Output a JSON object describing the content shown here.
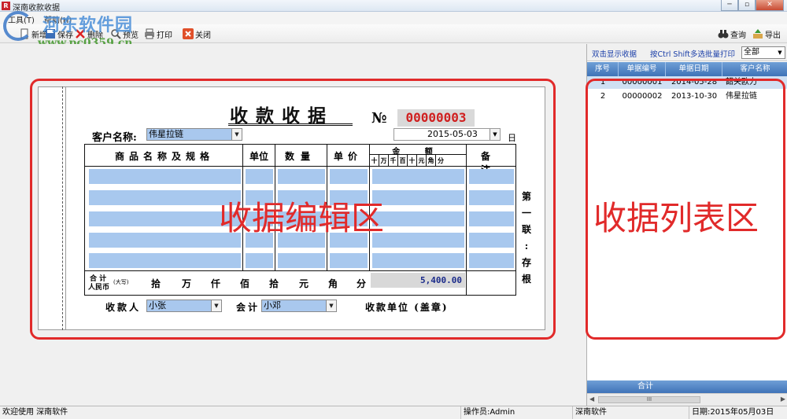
{
  "window": {
    "title": "深南收款收据",
    "controls": [
      "─",
      "▫",
      "✕"
    ]
  },
  "menu": [
    {
      "label": "工具(T)"
    },
    {
      "label": "帮助(H)"
    }
  ],
  "toolbar": {
    "left": [
      {
        "label": "新增"
      },
      {
        "label": "保存"
      },
      {
        "label": "删除"
      },
      {
        "label": "预览"
      },
      {
        "label": "打印"
      },
      {
        "label": "关闭"
      }
    ],
    "right": [
      {
        "label": "查询"
      },
      {
        "label": "导出"
      }
    ]
  },
  "watermark": {
    "name": "河东软件园",
    "url": "www.pc0359.cn"
  },
  "receipt": {
    "title": "收款收据",
    "no_label": "№",
    "number": "00000003",
    "customer_label": "客户名称:",
    "customer": "伟星拉链",
    "date": "2015-05-03",
    "day_label": "日",
    "headers": {
      "goods": "商品名称及规格",
      "unit": "单位",
      "qty": "数量",
      "price": "单价",
      "amount": "金 额",
      "note": "备 注"
    },
    "amount_digits": [
      "十",
      "万",
      "千",
      "百",
      "十",
      "元",
      "角",
      "分"
    ],
    "total_label_top": "合 计",
    "total_label_bottom": "人民币",
    "total_label_small": "(大写)",
    "total_words": [
      "拾",
      "万",
      "仟",
      "佰",
      "拾",
      "元",
      "角",
      "分"
    ],
    "total_value": "5,400.00",
    "side_text": [
      "第",
      "一",
      "联",
      ":",
      "存",
      "根"
    ],
    "receiver_label": "收款人",
    "receiver": "小张",
    "accountant_label": "会计",
    "accountant": "小邓",
    "unit_label": "收款单位 (盖章)"
  },
  "overlays": {
    "edit_area": "收据编辑区",
    "list_area": "收据列表区"
  },
  "list_panel": {
    "double_click_link": "双击显示收据",
    "multi_print_link": "按Ctrl Shift多选批量打印",
    "filter": "全部",
    "columns": [
      "序号",
      "单据编号",
      "单据日期",
      "客户名称"
    ],
    "rows": [
      {
        "seq": "1",
        "code": "00000001",
        "date": "2014-05-28",
        "customer": "韶关欧力"
      },
      {
        "seq": "2",
        "code": "00000002",
        "date": "2013-10-30",
        "customer": "伟星拉链"
      }
    ],
    "footer": "合计",
    "scroll_thumb": "III"
  },
  "status": {
    "welcome": "欢迎使用 深南软件",
    "operator": "操作员:Admin",
    "company": "深南软件",
    "date": "日期:2015年05月03日"
  },
  "colors": {
    "accent_blue": "#a8c8ee",
    "number_red": "#d02020",
    "annotation_red": "#e12a2a",
    "header_blue": "#3f73b8"
  }
}
